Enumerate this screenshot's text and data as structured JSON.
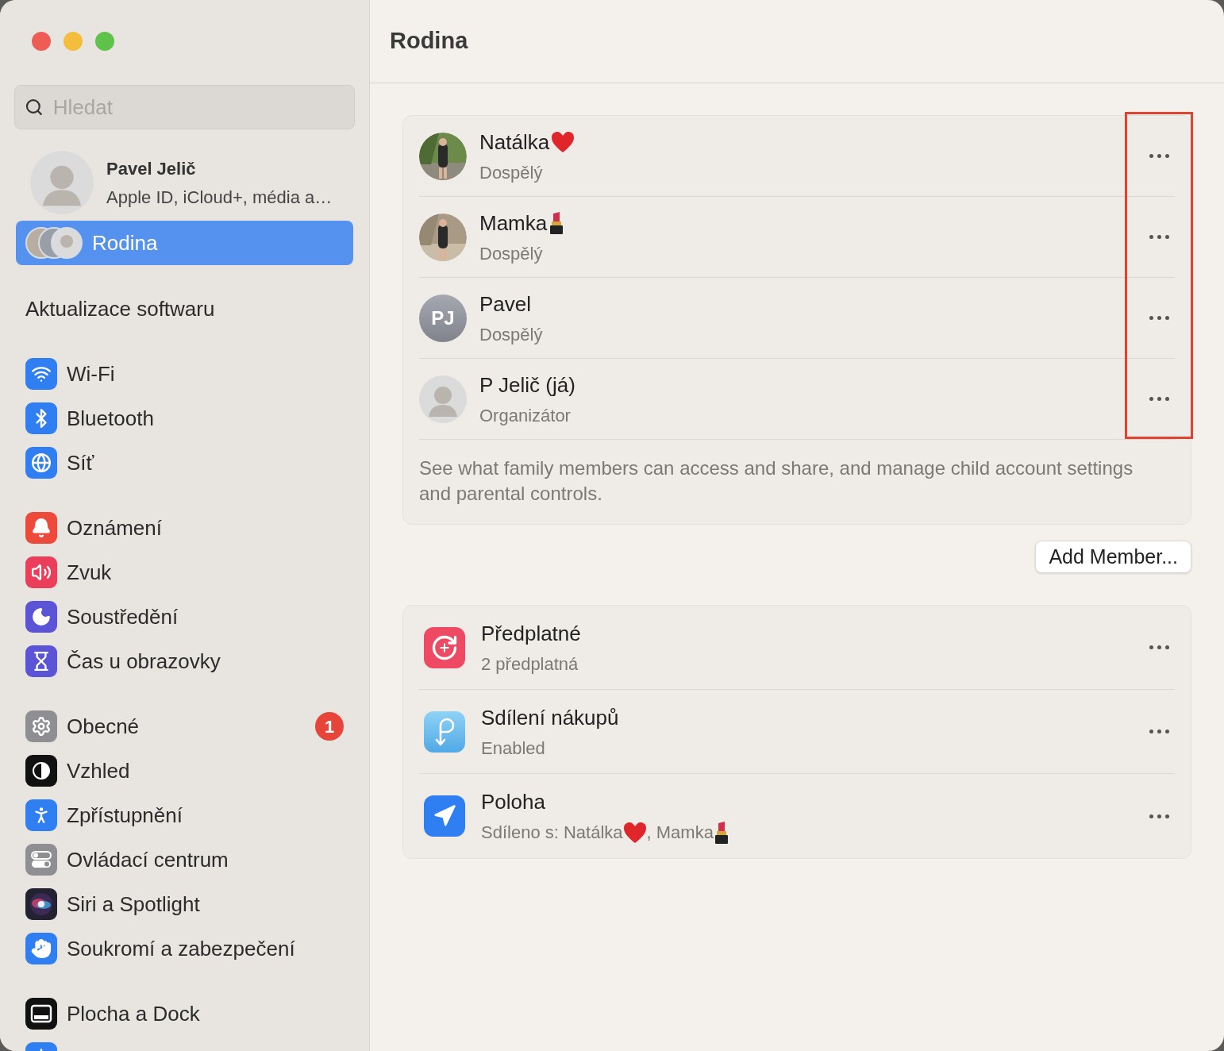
{
  "window": {
    "title": "Rodina"
  },
  "sidebar": {
    "search": {
      "placeholder": "Hledat"
    },
    "account": {
      "name": "Pavel Jelič",
      "subtitle": "Apple ID, iCloud+, média a…"
    },
    "groups": [
      [
        {
          "label": "Rodina",
          "kind": "family",
          "selected": true
        }
      ],
      [
        {
          "label": "Aktualizace softwaru",
          "kind": "text",
          "selected": false
        }
      ],
      [
        {
          "label": "Wi-Fi",
          "kind": "wifi",
          "selected": false
        },
        {
          "label": "Bluetooth",
          "kind": "bluetooth",
          "selected": false
        },
        {
          "label": "Síť",
          "kind": "globe",
          "selected": false
        }
      ],
      [
        {
          "label": "Oznámení",
          "kind": "bell",
          "selected": false
        },
        {
          "label": "Zvuk",
          "kind": "speaker",
          "selected": false
        },
        {
          "label": "Soustředění",
          "kind": "moon",
          "selected": false
        },
        {
          "label": "Čas u obrazovky",
          "kind": "hourglass",
          "selected": false
        }
      ],
      [
        {
          "label": "Obecné",
          "kind": "gear",
          "selected": false,
          "badge": "1"
        },
        {
          "label": "Vzhled",
          "kind": "appearance",
          "selected": false
        },
        {
          "label": "Zpřístupnění",
          "kind": "accessibility",
          "selected": false
        },
        {
          "label": "Ovládací centrum",
          "kind": "toggles",
          "selected": false
        },
        {
          "label": "Siri a Spotlight",
          "kind": "siri",
          "selected": false
        },
        {
          "label": "Soukromí a zabezpečení",
          "kind": "hand",
          "selected": false
        }
      ],
      [
        {
          "label": "Plocha a Dock",
          "kind": "dock",
          "selected": false
        },
        {
          "kind": "sun",
          "selected": false
        }
      ]
    ]
  },
  "members": [
    {
      "name": [
        {
          "kind": "text",
          "text": "Natálka"
        },
        {
          "kind": "heart"
        }
      ],
      "role": "Dospělý"
    },
    {
      "name": [
        {
          "kind": "text",
          "text": "Mamka"
        },
        {
          "kind": "lipstick"
        }
      ],
      "role": "Dospělý"
    },
    {
      "kind": "initials",
      "initials": "PJ",
      "name": [
        {
          "kind": "text",
          "text": "Pavel"
        }
      ],
      "role": "Dospělý"
    },
    {
      "kind": "memoji",
      "name": [
        {
          "kind": "text",
          "text": "P Jelič (já)"
        }
      ],
      "role": "Organizátor"
    }
  ],
  "members_note": "See what family members can access and share, and manage child account settings and parental controls.",
  "add_member_button": "Add Member...",
  "services": [
    {
      "kind": "subscriptions",
      "title": "Předplatné",
      "subtitle": [
        {
          "kind": "text",
          "text": "2 předplatná"
        }
      ]
    },
    {
      "kind": "purchases",
      "title": "Sdílení nákupů",
      "subtitle": [
        {
          "kind": "text",
          "text": "Enabled"
        }
      ]
    },
    {
      "kind": "location",
      "title": "Poloha",
      "subtitle": [
        {
          "kind": "text",
          "text": "Sdíleno s: Natálka"
        },
        {
          "kind": "heart"
        },
        {
          "kind": "text",
          "text": ", Mamka"
        },
        {
          "kind": "lipstick"
        }
      ]
    }
  ]
}
